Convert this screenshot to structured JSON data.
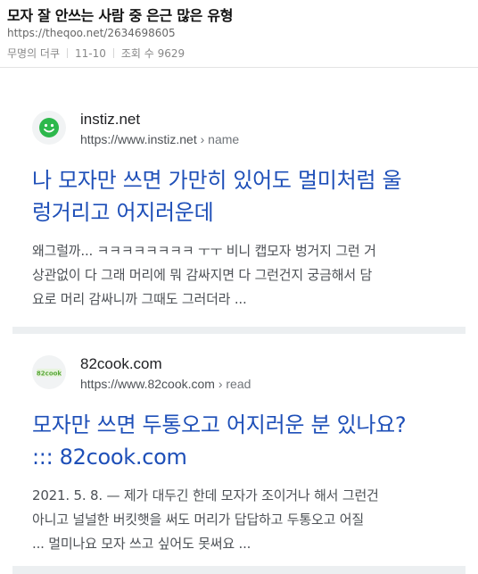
{
  "post": {
    "title": "모자 잘 안쓰는 사람 중 은근 많은 유형",
    "url": "https://theqoo.net/2634698605",
    "author": "무명의 더쿠",
    "date": "11-10",
    "views": "조회 수 9629"
  },
  "results": [
    {
      "site": "instiz.net",
      "url": "https://www.instiz.net",
      "crumb": "› name",
      "title_lines": [
        "나 모자만 쓰면 가만히 있어도 멀미처럼 울",
        "렁거리고 어지러운데"
      ],
      "snippet_lines": [
        "왜그럴까... ㅋㅋㅋㅋㅋㅋㅋㅋ ㅜㅜ 비니 캡모자 벙거지 그런 거",
        "상관없이 다 그래 머리에 뭐 감싸지면 다 그런건지 궁금해서 담",
        "요로 머리 감싸니까 그때도 그러더라 ..."
      ],
      "favicon_icon": "smiley-icon",
      "favicon_color": "#2db84c"
    },
    {
      "site": "82cook.com",
      "url": "https://www.82cook.com",
      "crumb": "› read",
      "title_lines": [
        "모자만 쓰면 두통오고 어지러운 분 있나요?",
        "::: 82cook.com"
      ],
      "snippet_lines": [
        "2021. 5. 8. — 제가 대두긴 한데 모자가 조이거나 해서 그런건",
        "아니고 널널한 버킷햇을 써도 머리가 답답하고 두통오고 어질",
        "... 멀미나요 모자 쓰고 싶어도 못써요 ..."
      ],
      "favicon_icon": "82cook-logo-icon",
      "favicon_color": "#5aa83a"
    }
  ]
}
